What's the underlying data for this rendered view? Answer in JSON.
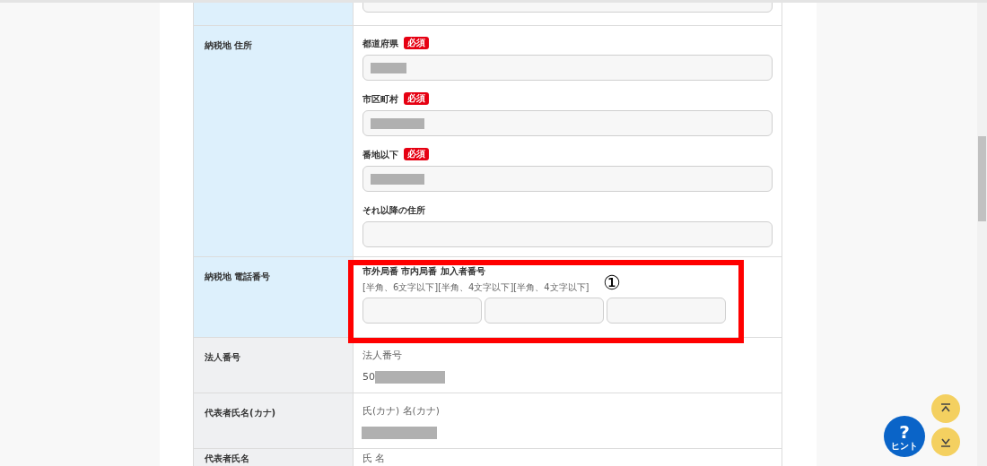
{
  "rows": [
    {
      "kind": "partial",
      "editable": true
    },
    {
      "kind": "address",
      "editable": true,
      "label": "納税地 住所",
      "fields": [
        {
          "label": "都道府県",
          "badge": "必須",
          "redacted": true
        },
        {
          "label": "市区町村",
          "badge": "必須",
          "redacted": true
        },
        {
          "label": "番地以下",
          "badge": "必須",
          "redacted": true
        },
        {
          "label": "それ以降の住所"
        }
      ]
    },
    {
      "kind": "phone",
      "editable": true,
      "label": "納税地 電話番号",
      "heading": "市外局番 市内局番 加入者番号",
      "hint": "[半角、6文字以下][半角、4文字以下][半角、4文字以下]",
      "inputs": [
        {
          "kind": "text"
        },
        {
          "kind": "text"
        },
        {
          "kind": "text"
        }
      ],
      "annotation": "①"
    },
    {
      "kind": "static",
      "editable": false,
      "label": "法人番号",
      "caption": "法人番号",
      "value": "50",
      "redacted": true
    },
    {
      "kind": "static",
      "editable": false,
      "label": "代表者氏名(カナ)",
      "caption": "氏(カナ) 名(カナ)",
      "redacted": true
    },
    {
      "kind": "static",
      "editable": false,
      "label": "代表者氏名",
      "caption": "氏 名"
    }
  ],
  "floating": {
    "hint_label": "ヒント",
    "hint_symbol": "?"
  }
}
